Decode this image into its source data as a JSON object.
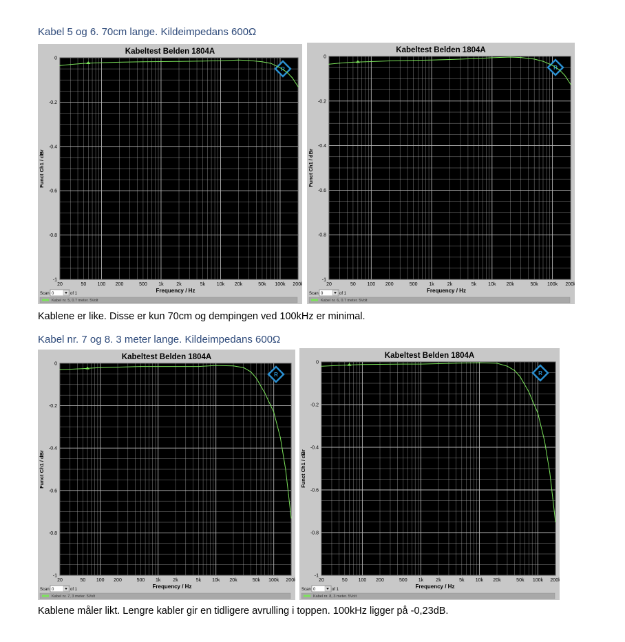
{
  "sections": [
    {
      "heading": "Kabel 5 og 6. 70cm lange. Kildeimpedans 600Ω",
      "caption": "Kablene er like. Disse er kun 70cm og dempingen ved 100kHz er minimal."
    },
    {
      "heading": "Kabel nr. 7 og 8.   3 meter lange. Kildeimpedans 600Ω",
      "caption": "Kablene måler likt. Lengre kabler gir en tidligere avrulling i toppen. 100kHz ligger på -0,23dB."
    }
  ],
  "colors": {
    "plot_bg": "#000000",
    "grid": "#bdbdbd",
    "trace": "#7be35a",
    "panel": "#c8c8c8",
    "logo": "#2a8fd0",
    "heading": "#2e4a7a"
  },
  "scan_label": "Scan",
  "scan_value": "0",
  "scan_of": "of 1",
  "chart_data": [
    {
      "type": "line",
      "title": "Kabeltest Belden 1804A",
      "xlabel": "Frequency / Hz",
      "ylabel": "Funct Ch1 / dBr",
      "x_scale": "log",
      "xlim": [
        20,
        200000
      ],
      "ylim": [
        -1,
        0
      ],
      "x_tick_labels": [
        "20",
        "50",
        "100",
        "200",
        "500",
        "1k",
        "2k",
        "5k",
        "10k",
        "20k",
        "50k",
        "100k",
        "200k"
      ],
      "y_tick_labels": [
        "0",
        "-0.2",
        "-0.4",
        "-0.6",
        "-0.8",
        "-1"
      ],
      "legend": "Kabel nr. 5, 0.7 meter. 5Volt",
      "series": [
        {
          "name": "Kabel nr. 5, 0.7 meter. 5Volt",
          "x": [
            20,
            30,
            50,
            100,
            200,
            500,
            1000,
            2000,
            5000,
            10000,
            20000,
            30000,
            50000,
            70000,
            100000,
            130000,
            160000,
            200000
          ],
          "y": [
            -0.035,
            -0.03,
            -0.025,
            -0.022,
            -0.02,
            -0.018,
            -0.017,
            -0.016,
            -0.015,
            -0.013,
            -0.01,
            -0.012,
            -0.018,
            -0.025,
            -0.045,
            -0.065,
            -0.09,
            -0.13
          ]
        }
      ]
    },
    {
      "type": "line",
      "title": "Kabeltest Belden 1804A",
      "xlabel": "Frequency / Hz",
      "ylabel": "Funct Ch1 / dBr",
      "x_scale": "log",
      "xlim": [
        20,
        200000
      ],
      "ylim": [
        -1,
        0
      ],
      "x_tick_labels": [
        "20",
        "50",
        "100",
        "200",
        "500",
        "1k",
        "2k",
        "5k",
        "10k",
        "20k",
        "50k",
        "100k",
        "200k"
      ],
      "y_tick_labels": [
        "0",
        "-0.2",
        "-0.4",
        "-0.6",
        "-0.8",
        "-1"
      ],
      "legend": "Kabel nr. 6, 0.7 meter. 5Volt",
      "series": [
        {
          "name": "Kabel nr. 6, 0.7 meter. 5Volt",
          "x": [
            20,
            30,
            50,
            100,
            200,
            500,
            1000,
            2000,
            5000,
            10000,
            20000,
            30000,
            50000,
            70000,
            100000,
            130000,
            160000,
            200000
          ],
          "y": [
            -0.035,
            -0.03,
            -0.026,
            -0.023,
            -0.02,
            -0.018,
            -0.016,
            -0.014,
            -0.01,
            -0.006,
            -0.003,
            -0.005,
            -0.012,
            -0.022,
            -0.04,
            -0.06,
            -0.085,
            -0.125
          ]
        }
      ]
    },
    {
      "type": "line",
      "title": "Kabeltest Belden 1804A",
      "xlabel": "Frequency / Hz",
      "ylabel": "Funct Ch1 / dBr",
      "x_scale": "log",
      "xlim": [
        20,
        200000
      ],
      "ylim": [
        -1,
        0
      ],
      "x_tick_labels": [
        "20",
        "50",
        "100",
        "200",
        "500",
        "1k",
        "2k",
        "5k",
        "10k",
        "20k",
        "50k",
        "100k",
        "200k"
      ],
      "y_tick_labels": [
        "0",
        "-0.2",
        "-0.4",
        "-0.6",
        "-0.8",
        "-1"
      ],
      "legend": "Kabel nr. 7, 3 meter. 5Volt",
      "series": [
        {
          "name": "Kabel nr. 7, 3 meter. 5Volt",
          "x": [
            20,
            50,
            100,
            500,
            1000,
            2000,
            5000,
            10000,
            20000,
            30000,
            40000,
            50000,
            70000,
            100000,
            130000,
            160000,
            180000,
            200000
          ],
          "y": [
            -0.03,
            -0.025,
            -0.02,
            -0.015,
            -0.015,
            -0.015,
            -0.015,
            -0.01,
            -0.012,
            -0.02,
            -0.04,
            -0.07,
            -0.14,
            -0.23,
            -0.35,
            -0.5,
            -0.62,
            -0.73
          ]
        }
      ]
    },
    {
      "type": "line",
      "title": "Kabeltest Belden 1804A",
      "xlabel": "Frequency / Hz",
      "ylabel": "Funct Ch1 / dBr",
      "x_scale": "log",
      "xlim": [
        20,
        200000
      ],
      "ylim": [
        -1,
        0
      ],
      "x_tick_labels": [
        "20",
        "50",
        "100",
        "200",
        "500",
        "1k",
        "2k",
        "5k",
        "10k",
        "20k",
        "50k",
        "100k",
        "200k"
      ],
      "y_tick_labels": [
        "0",
        "-0.2",
        "-0.4",
        "-0.6",
        "-0.8",
        "-1"
      ],
      "legend": "Kabel nr. 8, 3 meter. 5Volt",
      "series": [
        {
          "name": "Kabel nr. 8, 3 meter. 5Volt",
          "x": [
            20,
            50,
            100,
            500,
            1000,
            2000,
            5000,
            10000,
            20000,
            30000,
            40000,
            50000,
            70000,
            100000,
            130000,
            160000,
            180000,
            200000
          ],
          "y": [
            -0.02,
            -0.015,
            -0.012,
            -0.01,
            -0.01,
            -0.008,
            -0.005,
            -0.004,
            -0.006,
            -0.02,
            -0.04,
            -0.07,
            -0.14,
            -0.24,
            -0.37,
            -0.52,
            -0.64,
            -0.75
          ]
        }
      ]
    }
  ]
}
